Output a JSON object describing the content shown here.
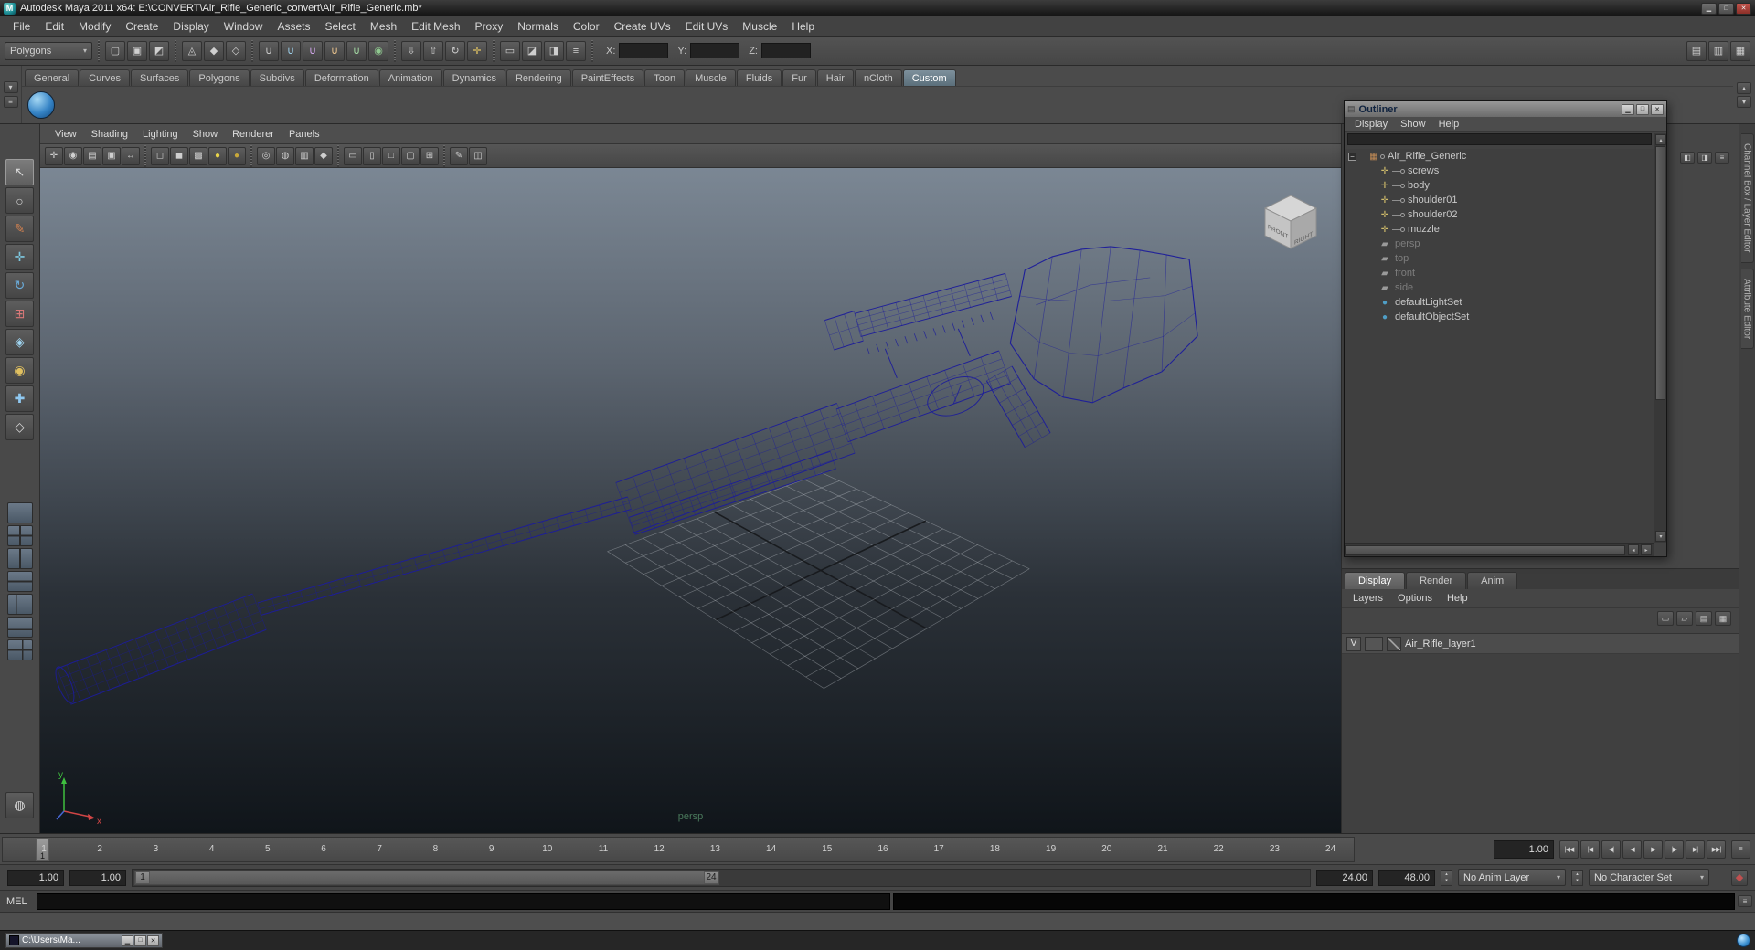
{
  "window": {
    "title": "Autodesk Maya 2011 x64: E:\\CONVERT\\Air_Rifle_Generic_convert\\Air_Rifle_Generic.mb*",
    "buttons": [
      {
        "name": "minimize-button",
        "glyph": "▁"
      },
      {
        "name": "maximize-button",
        "glyph": "□"
      },
      {
        "name": "close-button",
        "glyph": "✕"
      }
    ]
  },
  "glyphs": {
    "up": "▴",
    "down": "▾",
    "left": "◂",
    "right": "▸",
    "logo": "M",
    "outliner_icon": "▤",
    "script_editor": "≡"
  },
  "menubar": {
    "items": [
      "File",
      "Edit",
      "Modify",
      "Create",
      "Display",
      "Window",
      "Assets",
      "Select",
      "Mesh",
      "Edit Mesh",
      "Proxy",
      "Normals",
      "Color",
      "Create UVs",
      "Edit UVs",
      "Muscle",
      "Help"
    ]
  },
  "statusline": {
    "mode": "Polygons",
    "icons": [
      {
        "divider": true
      },
      {
        "name": "new-scene-icon",
        "glyph": "▢"
      },
      {
        "name": "open-scene-icon",
        "glyph": "▣"
      },
      {
        "name": "save-scene-icon",
        "glyph": "◩"
      },
      {
        "divider": true
      },
      {
        "name": "select-hierarchy-icon",
        "glyph": "◬"
      },
      {
        "name": "select-object-icon",
        "glyph": "◆"
      },
      {
        "name": "select-component-icon",
        "glyph": "◇"
      },
      {
        "divider": true
      },
      {
        "name": "snap-grid-icon",
        "glyph": "∪",
        "tint": "#cfcfcf"
      },
      {
        "name": "snap-curve-icon",
        "glyph": "∪",
        "tint": "#9fd4f0"
      },
      {
        "name": "snap-point-icon",
        "glyph": "∪",
        "tint": "#d6a9f0"
      },
      {
        "name": "snap-projected-center-icon",
        "glyph": "∪",
        "tint": "#f0c890"
      },
      {
        "name": "snap-view-plane-icon",
        "glyph": "∪",
        "tint": "#a8e0a8"
      },
      {
        "name": "make-live-icon",
        "glyph": "◉",
        "tint": "#8fc88f"
      },
      {
        "divider": true
      },
      {
        "name": "input-connections-icon",
        "glyph": "⇩"
      },
      {
        "name": "output-connections-icon",
        "glyph": "⇧"
      },
      {
        "name": "construction-history-icon",
        "glyph": "↻"
      },
      {
        "name": "selection-mask-icon",
        "glyph": "✛",
        "tint": "#e2c463"
      },
      {
        "divider": true
      },
      {
        "name": "render-view-icon",
        "glyph": "▭"
      },
      {
        "name": "render-current-frame-icon",
        "glyph": "◪"
      },
      {
        "name": "ipr-render-icon",
        "glyph": "◨"
      },
      {
        "name": "render-settings-icon",
        "glyph": "≡"
      },
      {
        "divider": true
      }
    ],
    "coord_labels": {
      "x": "X:",
      "y": "Y:",
      "z": "Z:"
    },
    "coord_values": {
      "x": "",
      "y": "",
      "z": ""
    },
    "right_icons": [
      {
        "name": "attribute-editor-toggle-icon",
        "glyph": "▤"
      },
      {
        "name": "tool-settings-toggle-icon",
        "glyph": "▥"
      },
      {
        "name": "channel-box-toggle-icon",
        "glyph": "▦"
      }
    ]
  },
  "shelf": {
    "tabs": [
      "General",
      "Curves",
      "Surfaces",
      "Polygons",
      "Subdivs",
      "Deformation",
      "Animation",
      "Dynamics",
      "Rendering",
      "PaintEffects",
      "Toon",
      "Muscle",
      "Fluids",
      "Fur",
      "Hair",
      "nCloth",
      "Custom"
    ],
    "active_tab": "Custom",
    "left_icons": [
      {
        "name": "shelf-tabs-menu-icon",
        "glyph": "▾"
      },
      {
        "name": "shelf-menu-icon",
        "glyph": "≡"
      }
    ]
  },
  "toolbox": {
    "tools": [
      {
        "name": "select-tool-icon",
        "glyph": "↖",
        "active": true
      },
      {
        "name": "lasso-tool-icon",
        "glyph": "○"
      },
      {
        "name": "paint-selection-tool-icon",
        "glyph": "✎",
        "tint": "#d08050"
      },
      {
        "name": "move-tool-icon",
        "glyph": "✛",
        "tint": "#7ec8e0"
      },
      {
        "name": "rotate-tool-icon",
        "glyph": "↻",
        "tint": "#6aaad8"
      },
      {
        "name": "scale-tool-icon",
        "glyph": "⊞",
        "tint": "#d87878"
      },
      {
        "name": "universal-manipulator-icon",
        "glyph": "◈",
        "tint": "#9fd4f0"
      },
      {
        "name": "soft-modification-icon",
        "glyph": "◉",
        "tint": "#e0c060"
      },
      {
        "name": "show-manipulator-icon",
        "glyph": "✚",
        "tint": "#8fc8f0"
      },
      {
        "name": "last-tool-icon",
        "glyph": "◇"
      }
    ],
    "layouts": [
      {
        "name": "single-pane-layout-icon",
        "cls": "lay1"
      },
      {
        "name": "four-pane-layout-icon",
        "cls": "lay4"
      },
      {
        "name": "two-pane-vertical-layout-icon",
        "cls": "lay2v"
      },
      {
        "name": "two-pane-horizontal-layout-icon",
        "cls": "lay2h"
      },
      {
        "name": "three-pane-split-layout-icon",
        "cls": "lay3"
      },
      {
        "name": "persp-graph-layout-icon",
        "cls": "lay2b"
      },
      {
        "name": "hypershade-persp-layout-icon",
        "cls": "lay3b"
      }
    ],
    "bottom_glyph": "◍"
  },
  "viewport": {
    "menus": [
      "View",
      "Shading",
      "Lighting",
      "Show",
      "Renderer",
      "Panels"
    ],
    "toolbar": [
      {
        "name": "select-camera-icon",
        "glyph": "✛"
      },
      {
        "name": "camera-attributes-icon",
        "glyph": "◉"
      },
      {
        "name": "bookmark-icon",
        "glyph": "▤"
      },
      {
        "name": "image-plane-icon",
        "glyph": "▣"
      },
      {
        "name": "two-d-pan-zoom-icon",
        "glyph": "↔"
      },
      {
        "divider": true
      },
      {
        "name": "wireframe-icon",
        "glyph": "◻"
      },
      {
        "name": "smooth-shade-icon",
        "glyph": "◼"
      },
      {
        "name": "textured-icon",
        "glyph": "▩"
      },
      {
        "name": "use-all-lights-icon",
        "glyph": "●",
        "tint": "#e8d44a"
      },
      {
        "name": "shadows-icon",
        "glyph": "●",
        "tint": "#c8a83a"
      },
      {
        "divider": true
      },
      {
        "name": "isolate-select-icon",
        "glyph": "◎"
      },
      {
        "name": "xray-icon",
        "glyph": "◍"
      },
      {
        "name": "wireframe-on-shaded-icon",
        "glyph": "▥"
      },
      {
        "name": "default-material-icon",
        "glyph": "◆"
      },
      {
        "divider": true
      },
      {
        "name": "resolution-gate-icon",
        "glyph": "▭"
      },
      {
        "name": "film-gate-icon",
        "glyph": "▯"
      },
      {
        "name": "safe-action-icon",
        "glyph": "□"
      },
      {
        "name": "safe-title-icon",
        "glyph": "▢"
      },
      {
        "name": "field-chart-icon",
        "glyph": "⊞"
      },
      {
        "divider": true
      },
      {
        "name": "grease-pencil-icon",
        "glyph": "✎"
      },
      {
        "name": "snapshot-icon",
        "glyph": "◫"
      }
    ],
    "camera_label": "persp",
    "axis": {
      "y": "y",
      "x": "x"
    },
    "cube": {
      "front": "FRONT",
      "right": "RIGHT"
    }
  },
  "outliner": {
    "title": "Outliner",
    "menus": [
      "Display",
      "Show",
      "Help"
    ],
    "buttons": [
      {
        "name": "outliner-minimize-button",
        "glyph": "▁"
      },
      {
        "name": "outliner-maximize-button",
        "glyph": "□"
      },
      {
        "name": "outliner-close-button",
        "glyph": "✕"
      }
    ],
    "items": [
      {
        "label": "Air_Rifle_Generic",
        "icon": "mesh",
        "expander": true,
        "connector": "dot"
      },
      {
        "label": "screws",
        "icon": "transform",
        "connector": "line"
      },
      {
        "label": "body",
        "icon": "transform",
        "connector": "line"
      },
      {
        "label": "shoulder01",
        "icon": "transform",
        "connector": "line"
      },
      {
        "label": "shoulder02",
        "icon": "transform",
        "connector": "line"
      },
      {
        "label": "muzzle",
        "icon": "transform",
        "connector": "line"
      },
      {
        "label": "persp",
        "icon": "camera",
        "dimmed": true
      },
      {
        "label": "top",
        "icon": "camera",
        "dimmed": true
      },
      {
        "label": "front",
        "icon": "camera",
        "dimmed": true
      },
      {
        "label": "side",
        "icon": "camera",
        "dimmed": true
      },
      {
        "label": "defaultLightSet",
        "icon": "set"
      },
      {
        "label": "defaultObjectSet",
        "icon": "set"
      }
    ]
  },
  "layers_panel": {
    "tabs": [
      "Display",
      "Render",
      "Anim"
    ],
    "active_tab": "Display",
    "menus": [
      "Layers",
      "Options",
      "Help"
    ],
    "op_icons": [
      {
        "name": "layer-options-icon",
        "glyph": "▭"
      },
      {
        "name": "empty-layer-button",
        "glyph": "▱"
      },
      {
        "name": "new-layer-button",
        "glyph": "▤"
      },
      {
        "name": "new-layer-from-selected-button",
        "glyph": "▦"
      }
    ],
    "layers": [
      {
        "visibility": "V",
        "name": "Air_Rifle_layer1"
      }
    ]
  },
  "right_panel_icons": [
    {
      "name": "channel-display-icon",
      "glyph": "◧"
    },
    {
      "name": "channel-settings-icon",
      "glyph": "◨"
    },
    {
      "name": "panel-menu-icon",
      "glyph": "≡"
    }
  ],
  "right_tabs": [
    "Channel Box / Layer Editor",
    "Attribute Editor"
  ],
  "timeline": {
    "ticks": [
      "1",
      "2",
      "3",
      "4",
      "5",
      "6",
      "7",
      "8",
      "9",
      "10",
      "11",
      "12",
      "13",
      "14",
      "15",
      "16",
      "17",
      "18",
      "19",
      "20",
      "21",
      "22",
      "23",
      "24"
    ],
    "current_frame": "1",
    "current_time": "1.00",
    "pref_glyph": "≡",
    "playback_buttons": [
      {
        "name": "go-to-start-button",
        "glyph": "|◀◀"
      },
      {
        "name": "step-back-frame-button",
        "glyph": "|◀"
      },
      {
        "name": "step-back-key-button",
        "glyph": "◀|"
      },
      {
        "name": "play-backward-button",
        "glyph": "◀"
      },
      {
        "name": "play-forward-button",
        "glyph": "▶"
      },
      {
        "name": "step-forward-key-button",
        "glyph": "|▶"
      },
      {
        "name": "step-forward-frame-button",
        "glyph": "▶|"
      },
      {
        "name": "go-to-end-button",
        "glyph": "▶▶|"
      }
    ]
  },
  "range_slider": {
    "anim_start": "1.00",
    "playback_start": "1.00",
    "handle_start": "1",
    "handle_end": "24",
    "playback_end": "24.00",
    "anim_end": "48.00",
    "anim_layer": "No Anim Layer",
    "character_set": "No Character Set",
    "autokey_glyph": "◆"
  },
  "command_line": {
    "label": "MEL"
  },
  "taskbar": {
    "window_title": "C:\\Users\\Ma...",
    "buttons": [
      {
        "name": "minimize-window-button",
        "glyph": "▁"
      },
      {
        "name": "restore-window-button",
        "glyph": "□"
      },
      {
        "name": "close-window-button",
        "glyph": "✕"
      }
    ]
  }
}
